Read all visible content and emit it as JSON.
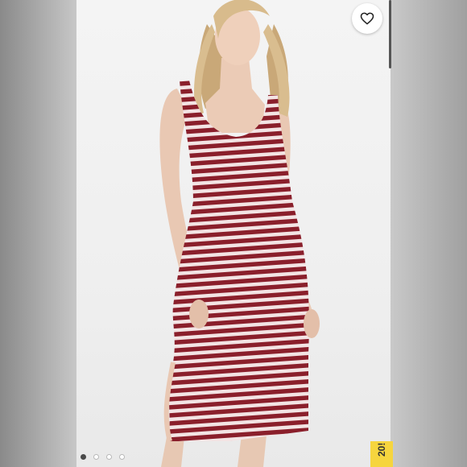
{
  "listing": {
    "image_count": 4,
    "active_image_index": 0,
    "badge_text": "20!"
  },
  "icons": {
    "favorite": "heart-outline-icon"
  },
  "colors": {
    "stripe_dark": "#8a1f2b",
    "stripe_light": "#f3e4e4",
    "badge_yellow": "#f6d53e"
  }
}
